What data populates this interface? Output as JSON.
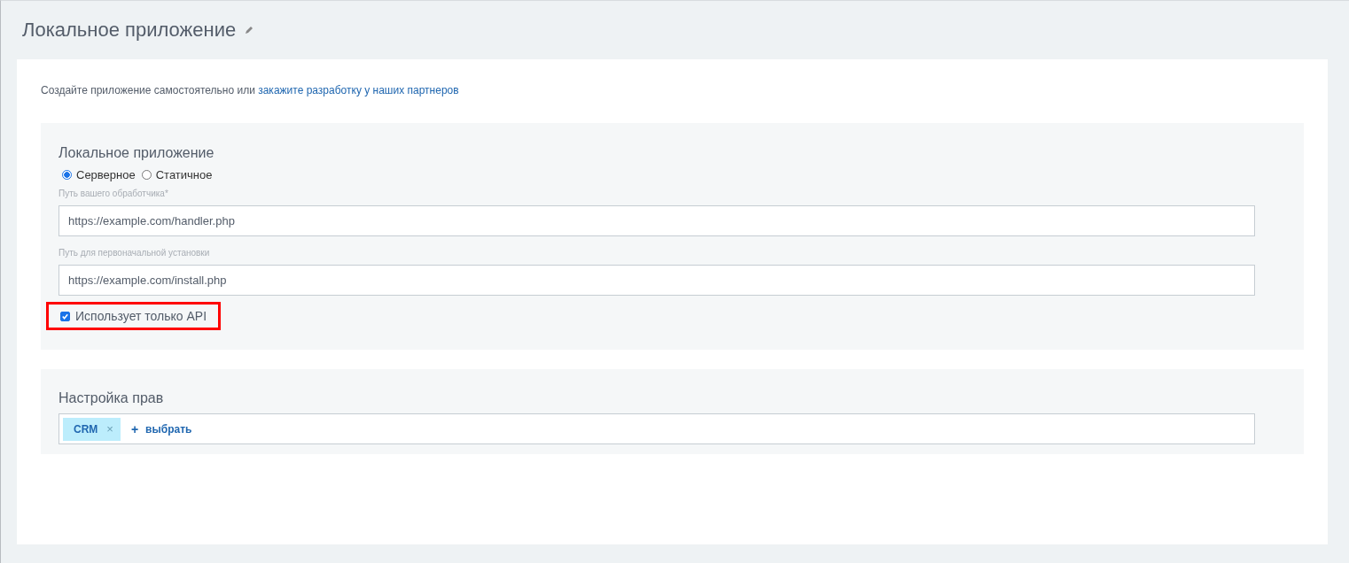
{
  "page_title": "Локальное приложение",
  "intro": {
    "text": "Создайте приложение самостоятельно или ",
    "link": "закажите разработку у наших партнеров"
  },
  "app_section": {
    "title": "Локальное приложение",
    "radios": [
      {
        "label": "Серверное",
        "selected": true
      },
      {
        "label": "Статичное",
        "selected": false
      }
    ],
    "fields": [
      {
        "label": "Путь вашего обработчика*",
        "value": "https://example.com/handler.php"
      },
      {
        "label": "Путь для первоначальной установки",
        "value": "https://example.com/install.php"
      }
    ],
    "checkbox": {
      "label": "Использует только API",
      "checked": true,
      "highlighted": true
    }
  },
  "rights_section": {
    "title": "Настройка прав",
    "tags": [
      {
        "label": "CRM",
        "remove": "×"
      }
    ],
    "add": {
      "icon": "+",
      "label": "выбрать"
    }
  }
}
